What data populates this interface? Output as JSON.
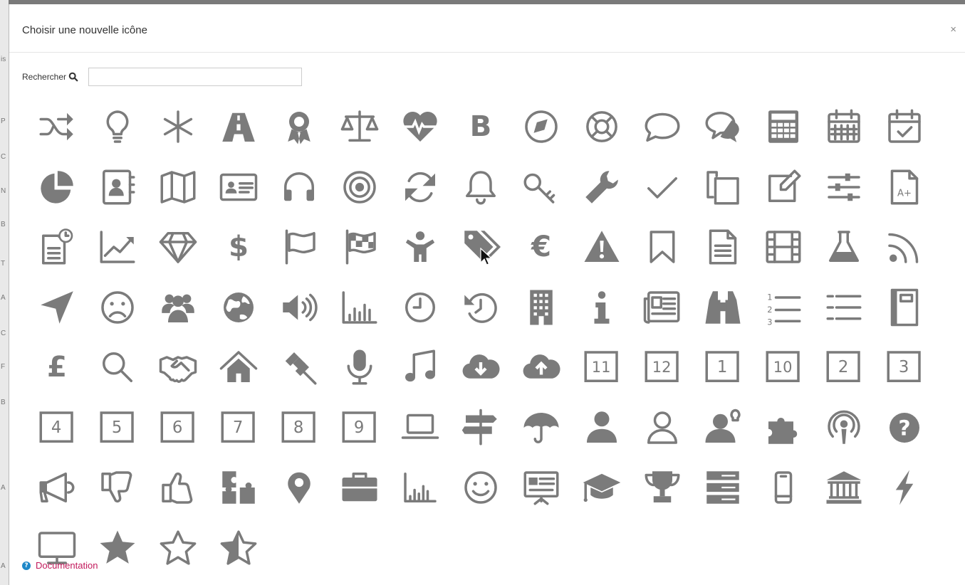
{
  "dialog": {
    "title": "Choisir une nouvelle icône",
    "close_label": "×"
  },
  "search": {
    "label": "Rechercher",
    "value": "",
    "placeholder": ""
  },
  "icons": [
    "shuffle-icon",
    "lightbulb-icon",
    "asterisk-icon",
    "road-icon",
    "award-icon",
    "balance-scale-icon",
    "heartbeat-icon",
    "bitcoin-icon",
    "compass-icon",
    "life-ring-icon",
    "comment-icon",
    "comments-icon",
    "calculator-icon",
    "calendar-icon",
    "calendar-check-icon",
    "pie-chart-icon",
    "contact-book-icon",
    "map-icon",
    "id-card-icon",
    "headphones-icon",
    "target-icon",
    "refresh-icon",
    "bell-icon",
    "key-icon",
    "wrench-icon",
    "checkmark-icon",
    "copy-icon",
    "edit-icon",
    "sliders-icon",
    "grade-a-plus-icon",
    "document-clock-icon",
    "line-chart-icon",
    "diamond-icon",
    "dollar-icon",
    "flag-outline-icon",
    "flag-checkered-icon",
    "child-icon",
    "tags-icon",
    "euro-icon",
    "warning-icon",
    "bookmark-icon",
    "file-text-icon",
    "film-icon",
    "flask-icon",
    "rss-icon",
    "location-arrow-icon",
    "frown-icon",
    "users-icon",
    "globe-icon",
    "volume-up-icon",
    "bar-chart-icon",
    "clock-icon",
    "history-icon",
    "building-icon",
    "info-icon",
    "newspaper-icon",
    "binoculars-icon",
    "ordered-list-icon",
    "list-icon",
    "notebook-icon",
    "pound-icon",
    "search-icon",
    "handshake-icon",
    "home-icon",
    "gavel-icon",
    "microphone-icon",
    "music-icon",
    "cloud-download-icon",
    "cloud-upload-icon",
    "number-11-icon",
    "number-12-icon",
    "number-1-icon",
    "number-10-icon",
    "number-2-icon",
    "number-3-icon",
    "number-4-icon",
    "number-5-icon",
    "number-6-icon",
    "number-7-icon",
    "number-8-icon",
    "number-9-icon",
    "laptop-icon",
    "signpost-icon",
    "umbrella-icon",
    "user-icon",
    "user-outline-icon",
    "user-idea-icon",
    "puzzle-piece-icon",
    "podcast-icon",
    "question-circle-icon",
    "bullhorn-icon",
    "thumbs-down-icon",
    "thumbs-up-icon",
    "puzzle-icon",
    "map-marker-icon",
    "briefcase-icon",
    "bar-chart-small-icon",
    "smile-icon",
    "presentation-icon",
    "graduation-cap-icon",
    "trophy-icon",
    "server-icon",
    "mobile-icon",
    "institution-icon",
    "bolt-icon",
    "desktop-icon",
    "star-icon",
    "star-outline-icon",
    "star-half-icon"
  ],
  "numbers": {
    "number-1-icon": "1",
    "number-2-icon": "2",
    "number-3-icon": "3",
    "number-4-icon": "4",
    "number-5-icon": "5",
    "number-6-icon": "6",
    "number-7-icon": "7",
    "number-8-icon": "8",
    "number-9-icon": "9",
    "number-10-icon": "10",
    "number-11-icon": "11",
    "number-12-icon": "12"
  },
  "glyphs": {
    "bitcoin-icon": "B",
    "dollar-icon": "$",
    "euro-icon": "€",
    "pound-icon": "£",
    "info-icon": "i",
    "question-circle-icon": "?",
    "grade-a-plus-icon": "A+"
  },
  "colors": {
    "icon": "#7b7b7b",
    "link": "#c2185b",
    "help": "#1e88c8"
  },
  "footer": {
    "doc_label": "Documentation"
  }
}
